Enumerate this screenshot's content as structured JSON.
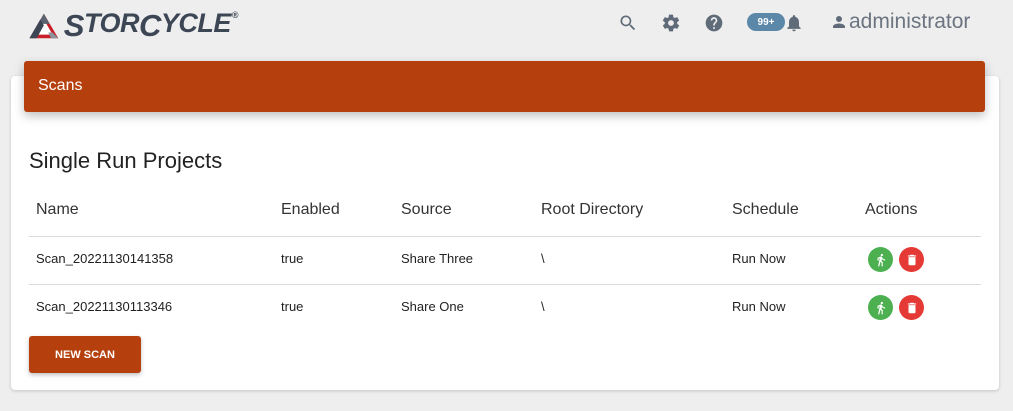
{
  "brand": {
    "name_first": "S",
    "name_rest": "TOR",
    "name_second": "C",
    "name_second_rest": "YCLE",
    "registered": "®"
  },
  "topbar": {
    "icons": [
      "search-icon",
      "gear-icon",
      "help-icon",
      "bell-icon",
      "user-icon"
    ],
    "notifications_badge": "99+",
    "username": "administrator"
  },
  "page_header": {
    "title": "Scans"
  },
  "section": {
    "title": "Single Run Projects"
  },
  "table": {
    "columns": [
      "Name",
      "Enabled",
      "Source",
      "Root Directory",
      "Schedule",
      "Actions"
    ],
    "rows": [
      {
        "name": "Scan_20221130141358",
        "enabled": "true",
        "source": "Share Three",
        "root": "\\",
        "schedule": "Run Now"
      },
      {
        "name": "Scan_20221130113346",
        "enabled": "true",
        "source": "Share One",
        "root": "\\",
        "schedule": "Run Now"
      }
    ],
    "action_icons": [
      "run-icon",
      "delete-icon"
    ]
  },
  "new_scan_button": "NEW SCAN",
  "colors": {
    "accent": "#b5400e",
    "run": "#4caf50",
    "delete": "#e53935",
    "badge": "#5b87a8"
  }
}
